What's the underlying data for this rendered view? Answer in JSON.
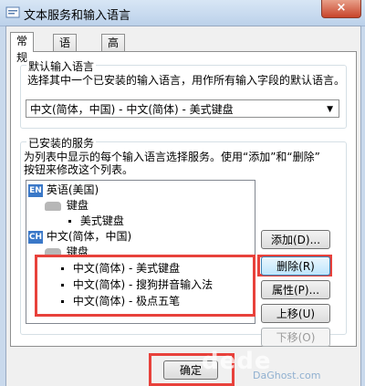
{
  "window": {
    "title": "文本服务和输入语言",
    "close_label": "×"
  },
  "tabs": [
    {
      "label": "常规",
      "active": true
    },
    {
      "label": "语言栏",
      "active": false
    },
    {
      "label": "高级键设置",
      "active": false
    }
  ],
  "default_input": {
    "legend": "默认输入语言",
    "description": "选择其中一个已安装的输入语言，用作所有输入字段的默认语言。",
    "selected": "中文(简体，中国) - 中文(简体) - 美式键盘"
  },
  "installed_services": {
    "legend": "已安装的服务",
    "description_line1": "为列表中显示的每个输入语言选择服务。使用“添加”和“删除”",
    "description_line2": "按钮来修改这个列表。",
    "tree": {
      "lang1": {
        "badge": "EN",
        "label": "英语(美国)"
      },
      "lang1_keyboard": "键盘",
      "lang1_item": "美式键盘",
      "lang2": {
        "badge": "CH",
        "label": "中文(简体，中国)"
      },
      "lang2_keyboard": "键盘",
      "lang2_items": [
        "中文(简体) - 美式键盘",
        "中文(简体) - 搜狗拼音输入法",
        "中文(简体) - 极点五笔"
      ]
    },
    "buttons": {
      "add": "添加(D)...",
      "remove": "删除(R)",
      "properties": "属性(P)...",
      "move_up": "上移(U)",
      "move_down": "下移(O)"
    }
  },
  "footer": {
    "ok": "确定"
  },
  "watermark": {
    "main": "dede",
    "sub": "DaGhost.com"
  },
  "colors": {
    "highlight_box": "#e8413b",
    "badge": "#3a78c8"
  }
}
